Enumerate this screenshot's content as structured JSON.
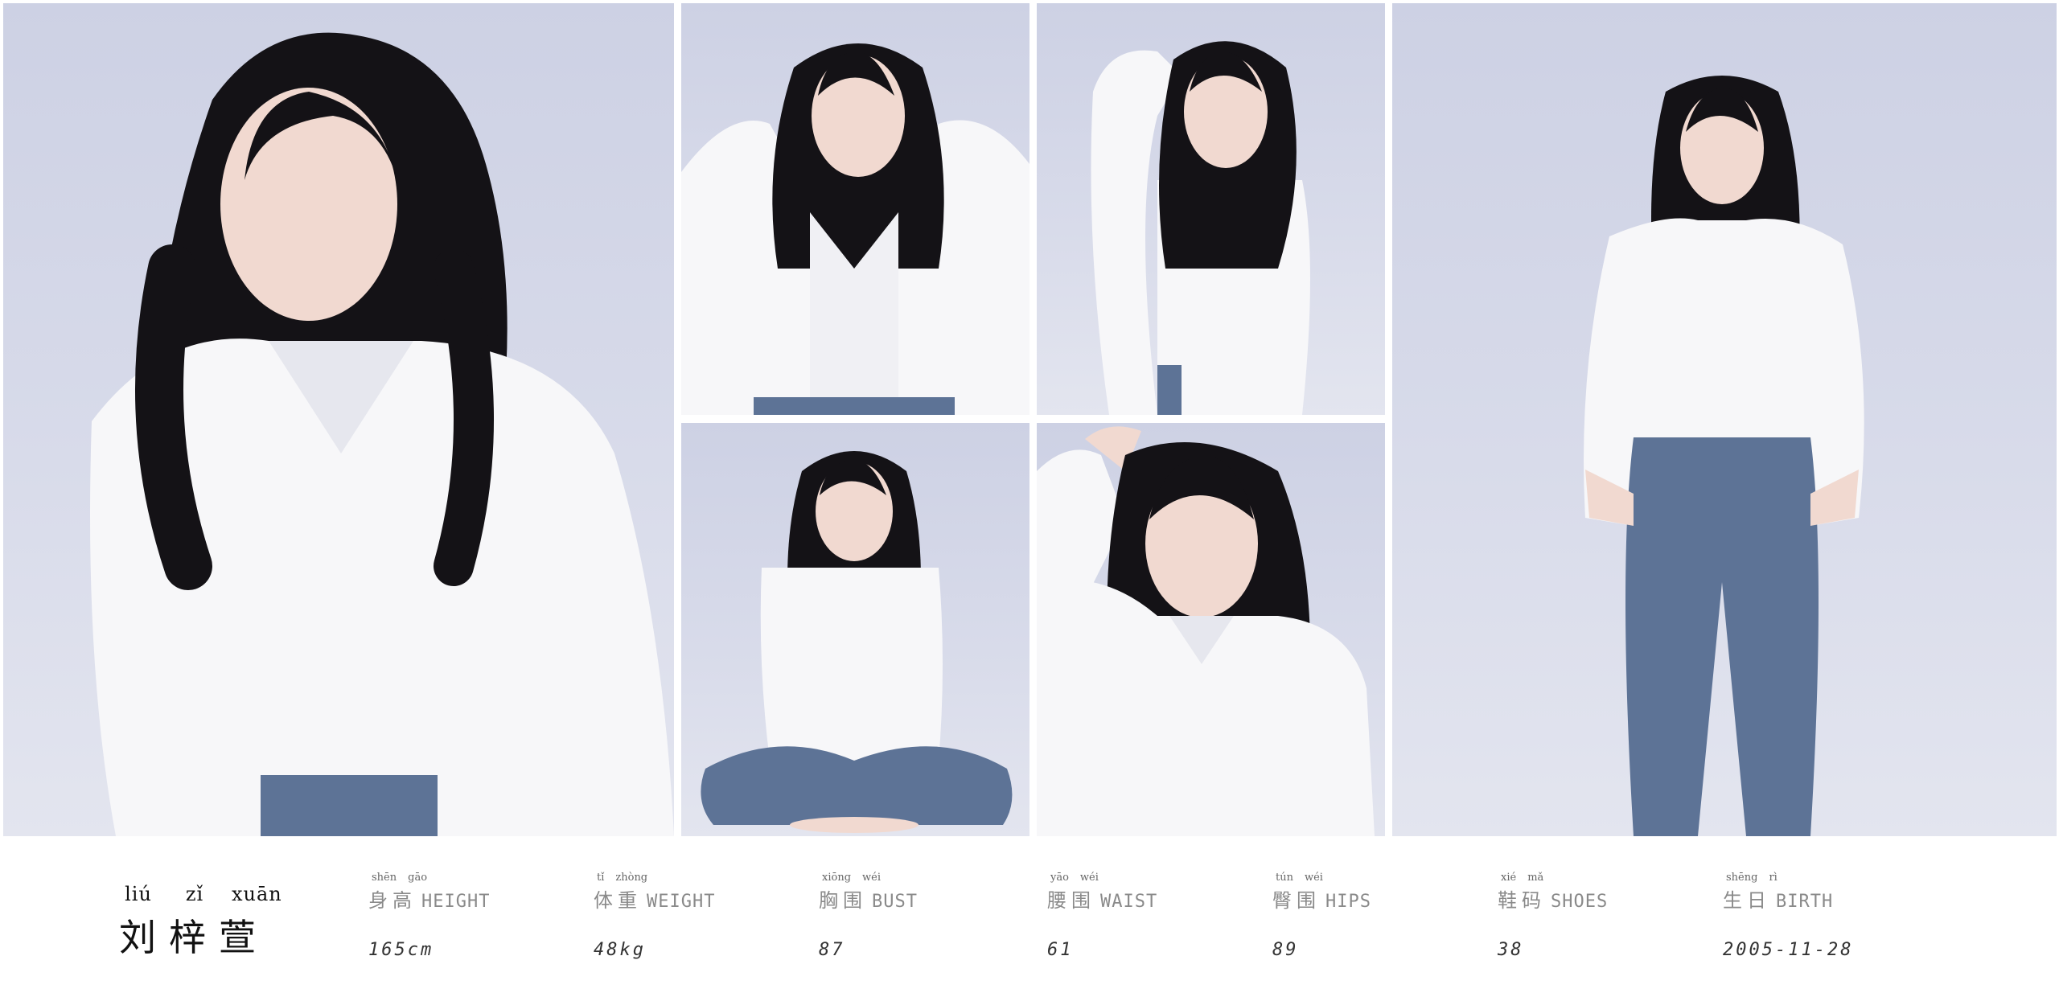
{
  "photos": [
    {
      "id": "p1",
      "pose": "close-up-portrait"
    },
    {
      "id": "p2",
      "pose": "hands-in-hair"
    },
    {
      "id": "p3",
      "pose": "hand-on-head"
    },
    {
      "id": "p4",
      "pose": "seated-cross-legged"
    },
    {
      "id": "p5",
      "pose": "hand-raised-portrait"
    },
    {
      "id": "p6",
      "pose": "full-body-standing"
    }
  ],
  "colors": {
    "backdrop": "#cdd1e4",
    "hair": "#141216",
    "shirt": "#f7f7f9",
    "jeans": "#5d7396",
    "skin": "#f1d9d0"
  },
  "model": {
    "name_pinyin": [
      "liú",
      "zǐ",
      "xuān"
    ],
    "name_cn": "刘梓萱"
  },
  "stats": [
    {
      "ruby": [
        "shēn",
        "gāo"
      ],
      "label_cn": "身高",
      "label_en": "HEIGHT",
      "value": "165cm"
    },
    {
      "ruby": [
        "tǐ",
        "zhòng"
      ],
      "label_cn": "体重",
      "label_en": "WEIGHT",
      "value": "48kg"
    },
    {
      "ruby": [
        "xiōng",
        "wéi"
      ],
      "label_cn": "胸围",
      "label_en": "BUST",
      "value": "87"
    },
    {
      "ruby": [
        "yāo",
        "wéi"
      ],
      "label_cn": "腰围",
      "label_en": "WAIST",
      "value": "61"
    },
    {
      "ruby": [
        "tún",
        "wéi"
      ],
      "label_cn": "臀围",
      "label_en": "HIPS",
      "value": "89"
    },
    {
      "ruby": [
        "xié",
        "mǎ"
      ],
      "label_cn": "鞋码",
      "label_en": "SHOES",
      "value": "38"
    },
    {
      "ruby": [
        "shēng",
        "rì"
      ],
      "label_cn": "生日",
      "label_en": "BIRTH",
      "value": "2005-11-28"
    }
  ]
}
